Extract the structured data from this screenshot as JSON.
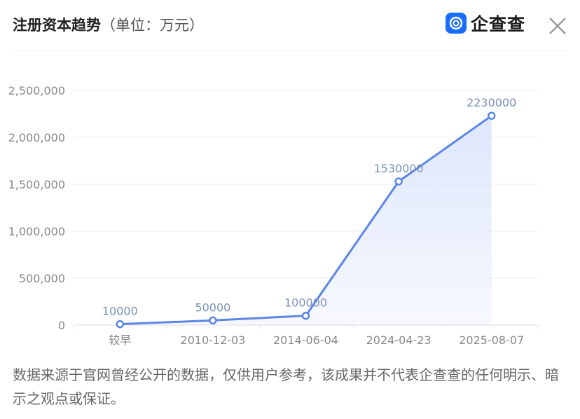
{
  "header": {
    "title": "注册资本趋势",
    "unit": "（单位：万元）",
    "brand_name": "企查查"
  },
  "chart_data": {
    "type": "area",
    "categories": [
      "较早",
      "2010-12-03",
      "2014-06-04",
      "2024-04-23",
      "2025-08-07"
    ],
    "values": [
      10000,
      50000,
      100000,
      1530000,
      2230000
    ],
    "data_labels": [
      "10000",
      "50000",
      "100000",
      "1530000",
      "2230000"
    ],
    "ylim": [
      0,
      2500000
    ],
    "yticks": [
      0,
      500000,
      1000000,
      1500000,
      2000000,
      2500000
    ],
    "ytick_labels": [
      "0",
      "500,000",
      "1,000,000",
      "1,500,000",
      "2,000,000",
      "2,500,000"
    ],
    "grid": true,
    "colors": {
      "line": "#5b86e5",
      "fill": "#dde6fb",
      "label": "#7b8fb8"
    }
  },
  "footer": {
    "disclaimer": "数据来源于官网曾经公开的数据，仅供用户参考，该成果并不代表企查查的任何明示、暗示之观点或保证。"
  }
}
